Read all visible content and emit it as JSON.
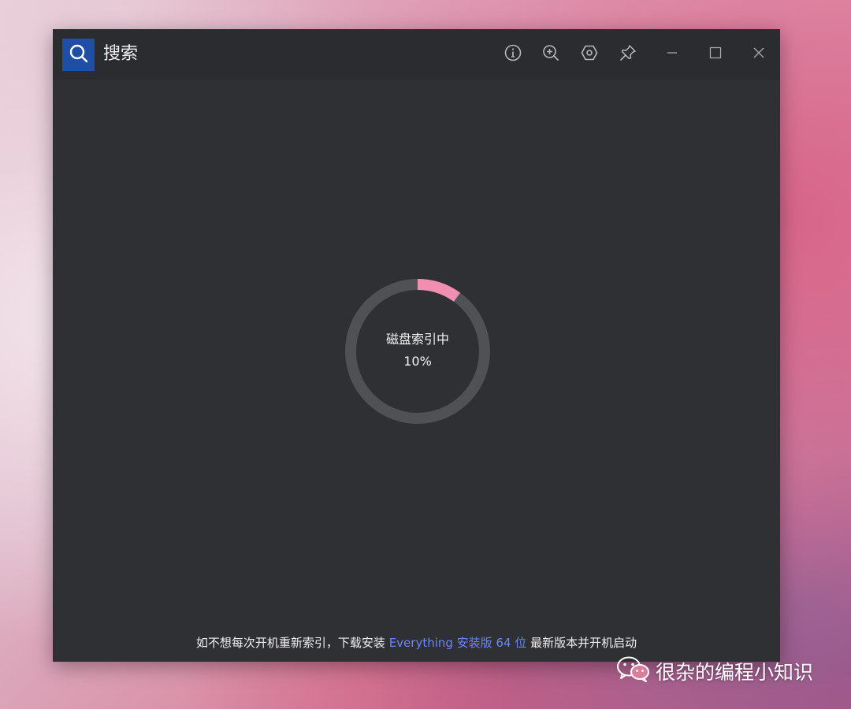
{
  "window": {
    "title": "搜索",
    "accent_color": "#1f4ea5",
    "background_color": "#2f3033"
  },
  "titlebar": {
    "buttons": [
      {
        "icon": "info-icon"
      },
      {
        "icon": "zoom-in-icon"
      },
      {
        "icon": "settings-icon"
      },
      {
        "icon": "pin-icon"
      }
    ],
    "window_controls": [
      {
        "icon": "minimize-icon"
      },
      {
        "icon": "maximize-icon"
      },
      {
        "icon": "close-icon"
      }
    ]
  },
  "indexing": {
    "label": "磁盘索引中",
    "percent_text": "10%",
    "progress": 0.1,
    "progress_color": "#f08fb0",
    "track_color": "#505154"
  },
  "footer": {
    "text_before": "如不想每次开机重新索引，下载安装 ",
    "link_text": "Everything 安装版 64 位",
    "text_after": " 最新版本并开机启动",
    "link_color": "#6a86ff"
  },
  "watermark": {
    "text": "很杂的编程小知识",
    "icon": "wechat-icon"
  }
}
